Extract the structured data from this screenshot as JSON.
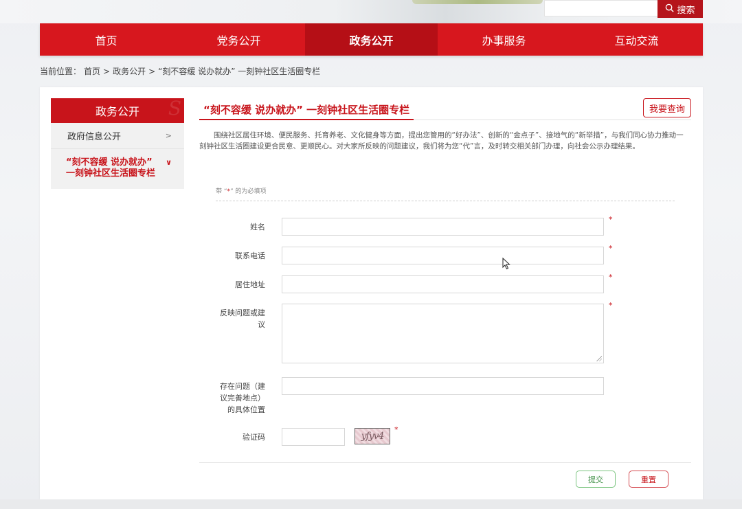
{
  "header": {
    "search_button_label": "搜索"
  },
  "nav": {
    "items": [
      {
        "label": "首页"
      },
      {
        "label": "党务公开"
      },
      {
        "label": "政务公开",
        "active": true
      },
      {
        "label": "办事服务"
      },
      {
        "label": "互动交流"
      }
    ]
  },
  "breadcrumb": {
    "prefix": "当前位置：",
    "items": [
      "首页",
      ">",
      "政务公开",
      ">",
      "“刻不容缓 说办就办” 一刻钟社区生活圈专栏"
    ]
  },
  "sidebar": {
    "title": "政务公开",
    "items": [
      {
        "label": "政府信息公开",
        "arrow": ">"
      },
      {
        "label_line1": "“刻不容缓 说办就办”",
        "label_line2": "一刻钟社区生活圈专栏",
        "arrow": "∨",
        "active": true
      }
    ]
  },
  "main": {
    "title": "“刻不容缓 说办就办” 一刻钟社区生活圈专栏",
    "query_button": "我要查询",
    "intro": "围绕社区居住环境、便民服务、托育养老、文化健身等方面，提出您管用的“好办法”、创新的“金点子”、接地气的“新举措”，与我们同心协力推动一刻钟社区生活圈建设更合民意、更顺民心。对大家所反映的问题建议，我们将为您“代”言，及时转交相关部门办理，向社会公示办理结果。",
    "required_note_pre": "带 “",
    "required_note_mark": "*",
    "required_note_post": "” 的为必填项"
  },
  "form": {
    "name_label": "姓名",
    "phone_label": "联系电话",
    "address_label": "居住地址",
    "suggestion_label_line1": "反映问题或建",
    "suggestion_label_line2": "议",
    "location_label_line1": "存在问题（建",
    "location_label_line2": "议完善地点）",
    "location_label_line3": "的具体位置",
    "captcha_label": "验证码",
    "captcha_text": "yfyv4",
    "required_star": "*",
    "submit_label": "提交",
    "reset_label": "重置"
  },
  "colors": {
    "brand_red": "#d7171e",
    "active_red": "#b50f16",
    "submit_green": "#3f8f45"
  }
}
